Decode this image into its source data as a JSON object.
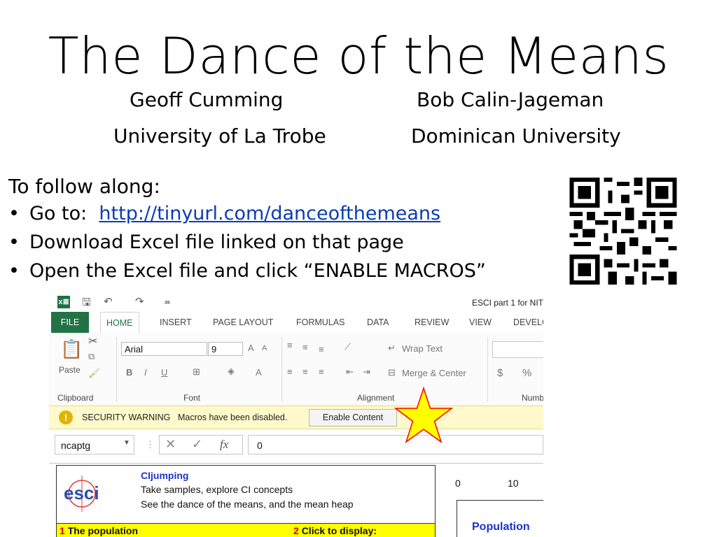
{
  "slide": {
    "title": "The Dance of the Means",
    "authors": [
      {
        "name": "Geoff Cumming",
        "affiliation": "University of La Trobe"
      },
      {
        "name": "Bob Calin-Jageman",
        "affiliation": "Dominican University"
      }
    ],
    "intro": "To follow along:",
    "bullets": [
      {
        "bullet": "•",
        "prefix": "Go to:  ",
        "link": "http://tinyurl.com/danceofthemeans"
      },
      {
        "bullet": "•",
        "text": "Download Excel file linked on that page"
      },
      {
        "bullet": "•",
        "text": "Open the Excel file and click “ENABLE MACROS”"
      }
    ],
    "qr_icon": "qr-code-icon"
  },
  "excel": {
    "window_title": "ESCI part 1 for NIT",
    "tabs": [
      "FILE",
      "HOME",
      "INSERT",
      "PAGE LAYOUT",
      "FORMULAS",
      "DATA",
      "REVIEW",
      "VIEW",
      "DEVELO"
    ],
    "active_tab": "HOME",
    "ribbon": {
      "clipboard": {
        "paste_label": "Paste",
        "group_label": "Clipboard"
      },
      "font": {
        "font_name": "Arial",
        "font_size": "9",
        "grow": "A",
        "shrink": "A",
        "bold": "B",
        "italic": "I",
        "underline": "U",
        "font_color": "A",
        "group_label": "Font"
      },
      "alignment": {
        "wrap_text": "Wrap Text",
        "merge_center": "Merge & Center",
        "group_label": "Alignment"
      },
      "number": {
        "currency": "$",
        "percent": "%",
        "group_label": "Numb"
      }
    },
    "security_bar": {
      "title": "SECURITY WARNING",
      "message": "Macros have been disabled.",
      "button": "Enable Content",
      "icon": "!"
    },
    "formula_bar": {
      "name_box": "ncaptg",
      "cancel": "✕",
      "enter": "✓",
      "fx": "fx",
      "value": "0"
    },
    "sheet": {
      "logo_text": "esci",
      "title": "CIjumping",
      "lines": [
        "Take samples, explore CI concepts",
        "See the dance of the means, and the mean heap"
      ],
      "row1": {
        "num1": "1",
        "label1": "The population",
        "num2": "2",
        "label2": "Click to display:"
      },
      "chart": {
        "tick0": "0",
        "tick10": "10",
        "series_label": "Population"
      }
    }
  },
  "colors": {
    "excel_green": "#217346",
    "security_yellow": "#fff9cb",
    "star_fill": "#ffff00",
    "star_stroke": "#ff0000",
    "link_blue": "#0a3cb4"
  }
}
